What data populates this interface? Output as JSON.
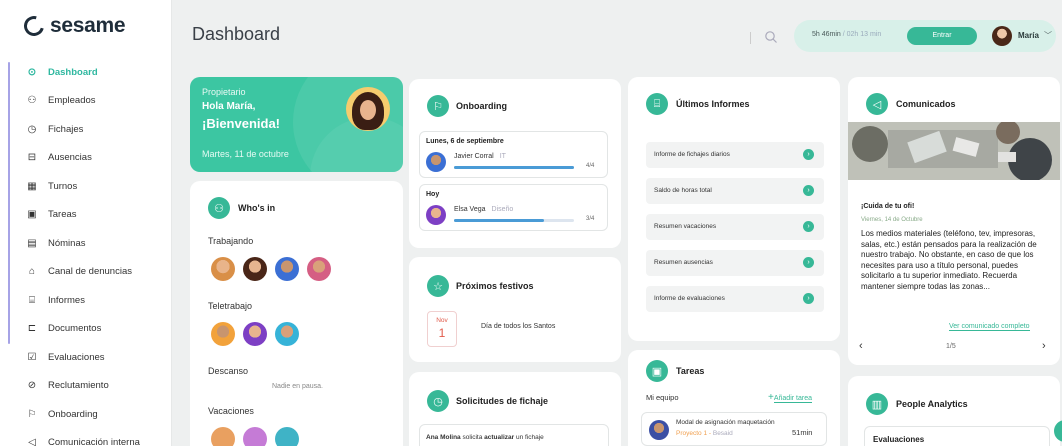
{
  "app": {
    "brand": "sesame"
  },
  "sidebar": {
    "items": [
      {
        "label": "Dashboard",
        "icon": "dashboard-icon"
      },
      {
        "label": "Empleados",
        "icon": "people-icon"
      },
      {
        "label": "Fichajes",
        "icon": "clock-icon"
      },
      {
        "label": "Ausencias",
        "icon": "absence-icon"
      },
      {
        "label": "Turnos",
        "icon": "calendar-icon"
      },
      {
        "label": "Tareas",
        "icon": "clipboard-icon"
      },
      {
        "label": "Nóminas",
        "icon": "payslip-icon"
      },
      {
        "label": "Canal de denuncias",
        "icon": "megaphone-icon"
      },
      {
        "label": "Informes",
        "icon": "reports-icon"
      },
      {
        "label": "Documentos",
        "icon": "folder-icon"
      },
      {
        "label": "Evaluaciones",
        "icon": "checkbox-icon"
      },
      {
        "label": "Reclutamiento",
        "icon": "recruit-icon"
      },
      {
        "label": "Onboarding",
        "icon": "signpost-icon"
      },
      {
        "label": "Comunicación interna",
        "icon": "speaker-icon"
      }
    ]
  },
  "header": {
    "title": "Dashboard",
    "worked": "5h 46min",
    "worked_sep": " / ",
    "remaining": "02h 13 min",
    "enter_label": "Entrar",
    "user_name": "María",
    "accent": "#37b897"
  },
  "welcome": {
    "role": "Propietario",
    "greeting": "Hola María,",
    "welcome": "¡Bienvenida!",
    "date": "Martes, 11 de octubre"
  },
  "whos_in": {
    "title": "Who's in",
    "working_label": "Trabajando",
    "remote_label": "Teletrabajo",
    "break_label": "Descanso",
    "break_empty": "Nadie en pausa.",
    "vacation_label": "Vacaciones"
  },
  "onboarding": {
    "title": "Onboarding",
    "groups": [
      {
        "date": "Lunes, 6 de septiembre",
        "name": "Javier Corral",
        "dept": "IT",
        "count": "4/4",
        "progress": 1.0
      },
      {
        "date": "Hoy",
        "name": "Elsa Vega",
        "dept": "Diseño",
        "count": "3/4",
        "progress": 0.75
      }
    ]
  },
  "festivos": {
    "title": "Próximos festivos",
    "month": "Nov",
    "day": "1",
    "name": "Día de todos los Santos"
  },
  "solicitudes": {
    "title": "Solicitudes de fichaje",
    "item_name": "Ana Molina",
    "item_mid": " solicita ",
    "item_action": "actualizar",
    "item_tail": " un fichaje"
  },
  "informes": {
    "title": "Últimos Informes",
    "items": [
      "Informe de fichajes diarios",
      "Saldo de horas total",
      "Resumen vacaciones",
      "Resumen ausencias",
      "Informe de evaluaciones"
    ]
  },
  "tareas": {
    "title": "Tareas",
    "team_label": "Mi equipo",
    "add_label": "Añadir tarea",
    "task_title": "Modal de asignación maquetación",
    "task_project": "Proyecto 1",
    "task_sep": " - ",
    "task_person": "Besaid",
    "task_time": "51min"
  },
  "comunicados": {
    "title": "Comunicados",
    "post_title": "¡Cuida de tu ofi!",
    "post_date": "Viernes, 14 de Octubre",
    "post_body": "Los medios materiales (teléfono, tev, impresoras, salas, etc.) están pensados para la realización de nuestro trabajo. No obstante, en caso de que los necesites para uso a título personal, puedes solicitarlo a tu superior inmediato. Recuerda mantener siempre todas las zonas...",
    "more_label": "Ver comunicado completo",
    "page": "1/5"
  },
  "analytics": {
    "title": "People Analytics",
    "section": "Evaluaciones"
  }
}
